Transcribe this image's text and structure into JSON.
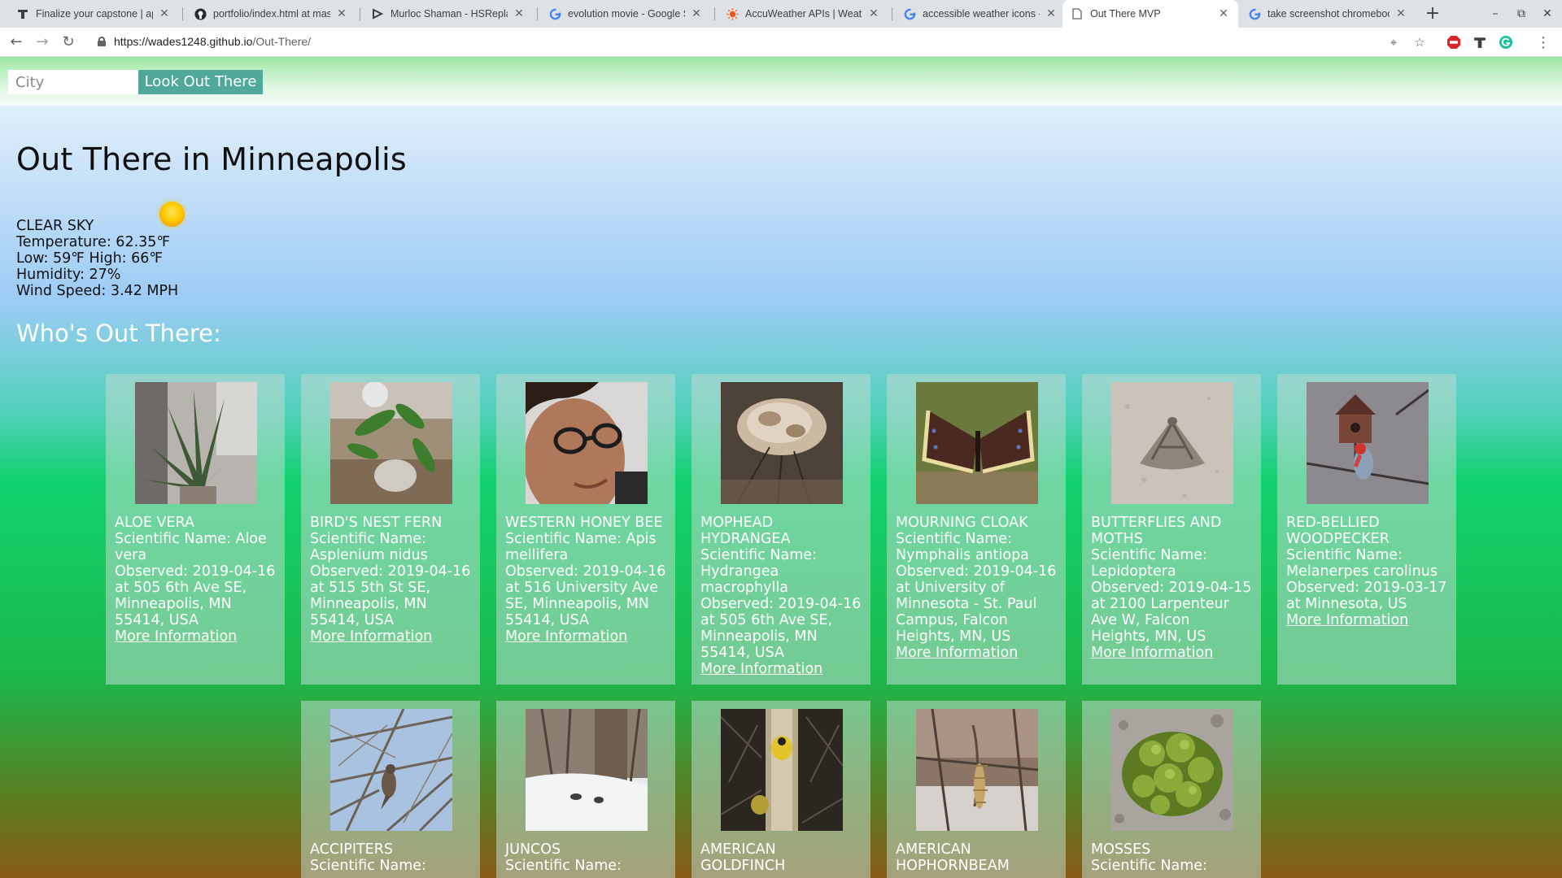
{
  "browser": {
    "tabs": [
      {
        "title": "Finalize your capstone | api-",
        "icon": "thinkful-icon"
      },
      {
        "title": "portfolio/index.html at mast",
        "icon": "github-icon"
      },
      {
        "title": "Murloc Shaman - HSReplay.",
        "icon": "hsreplay-icon"
      },
      {
        "title": "evolution movie - Google Se",
        "icon": "google-icon"
      },
      {
        "title": "AccuWeather APIs | Weathe",
        "icon": "accuweather-icon"
      },
      {
        "title": "accessible weather icons - G",
        "icon": "google-icon"
      },
      {
        "title": "Out There MVP",
        "icon": "page-icon"
      },
      {
        "title": "take screenshot chromebook",
        "icon": "google-icon"
      }
    ],
    "url_host": "https://wades1248.github.io",
    "url_path": "/Out-There/"
  },
  "search": {
    "placeholder": "City",
    "value": "",
    "button_label": "Look Out There"
  },
  "page_title": "Out There in Minneapolis",
  "weather": {
    "condition": "CLEAR SKY",
    "temperature": "Temperature: 62.35℉",
    "low_high": "Low: 59℉ High: 66℉",
    "humidity": "Humidity: 27%",
    "wind": "Wind Speed: 3.42 MPH",
    "icon": "sun-icon"
  },
  "section_heading": "Who's Out There:",
  "more_label": "More Information",
  "organisms": [
    {
      "common": "ALOE VERA",
      "sci": "Scientific Name: Aloe vera",
      "obs": "Observed: 2019-04-16 at 505 6th Ave SE, Minneapolis, MN 55414, USA",
      "photo": "aloe-vera-photo"
    },
    {
      "common": "BIRD'S NEST FERN",
      "sci": "Scientific Name: Asplenium nidus",
      "obs": "Observed: 2019-04-16 at 515 5th St SE, Minneapolis, MN 55414, USA",
      "photo": "birds-nest-fern-photo"
    },
    {
      "common": "WESTERN HONEY BEE",
      "sci": "Scientific Name: Apis mellifera",
      "obs": "Observed: 2019-04-16 at 516 University Ave SE, Minneapolis, MN 55414, USA",
      "photo": "western-honey-bee-photo"
    },
    {
      "common": "MOPHEAD HYDRANGEA",
      "sci": "Scientific Name: Hydrangea macrophylla",
      "obs": "Observed: 2019-04-16 at 505 6th Ave SE, Minneapolis, MN 55414, USA",
      "photo": "mophead-hydrangea-photo"
    },
    {
      "common": "MOURNING CLOAK",
      "sci": "Scientific Name: Nymphalis antiopa",
      "obs": "Observed: 2019-04-16 at University of Minnesota - St. Paul Campus, Falcon Heights, MN, US",
      "photo": "mourning-cloak-photo"
    },
    {
      "common": "BUTTERFLIES AND MOTHS",
      "sci": "Scientific Name: Lepidoptera",
      "obs": "Observed: 2019-04-15 at 2100 Larpenteur Ave W, Falcon Heights, MN, US",
      "photo": "moth-photo"
    },
    {
      "common": "RED-BELLIED WOODPECKER",
      "sci": "Scientific Name: Melanerpes carolinus",
      "obs": "Observed: 2019-03-17 at Minnesota, US",
      "photo": "woodpecker-photo"
    },
    {
      "common": "ACCIPITERS",
      "sci": "Scientific Name:",
      "obs": "",
      "photo": "hawk-photo"
    },
    {
      "common": "JUNCOS",
      "sci": "Scientific Name:",
      "obs": "",
      "photo": "juncos-photo"
    },
    {
      "common": "AMERICAN GOLDFINCH",
      "sci": "",
      "obs": "",
      "photo": "goldfinch-photo"
    },
    {
      "common": "AMERICAN HOPHORNBEAM",
      "sci": "",
      "obs": "",
      "photo": "hophornbeam-photo"
    },
    {
      "common": "MOSSES",
      "sci": "Scientific Name:",
      "obs": "",
      "photo": "moss-photo"
    }
  ]
}
